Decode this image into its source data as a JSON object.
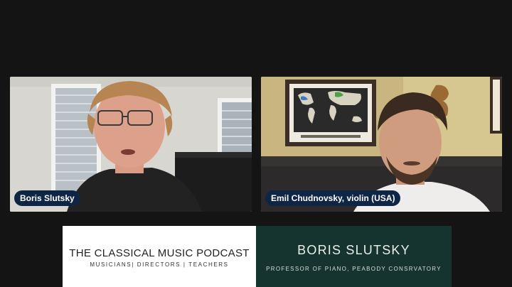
{
  "participants": [
    {
      "name": "Boris Slutsky"
    },
    {
      "name": "Emil Chudnovsky, violin (USA)"
    }
  ],
  "lower_third": {
    "podcast_title": "THE CLASSICAL MUSIC PODCAST",
    "podcast_subtitle": "MUSICIANS| DIRECTORS | TEACHERS",
    "guest_name": "BORIS SLUTSKY",
    "guest_role": "PROFESSOR OF PIANO, PEABODY CONSRVATORY"
  },
  "colors": {
    "background": "#141414",
    "name_tag": "#0f2545",
    "banner_dark": "#15332f"
  }
}
